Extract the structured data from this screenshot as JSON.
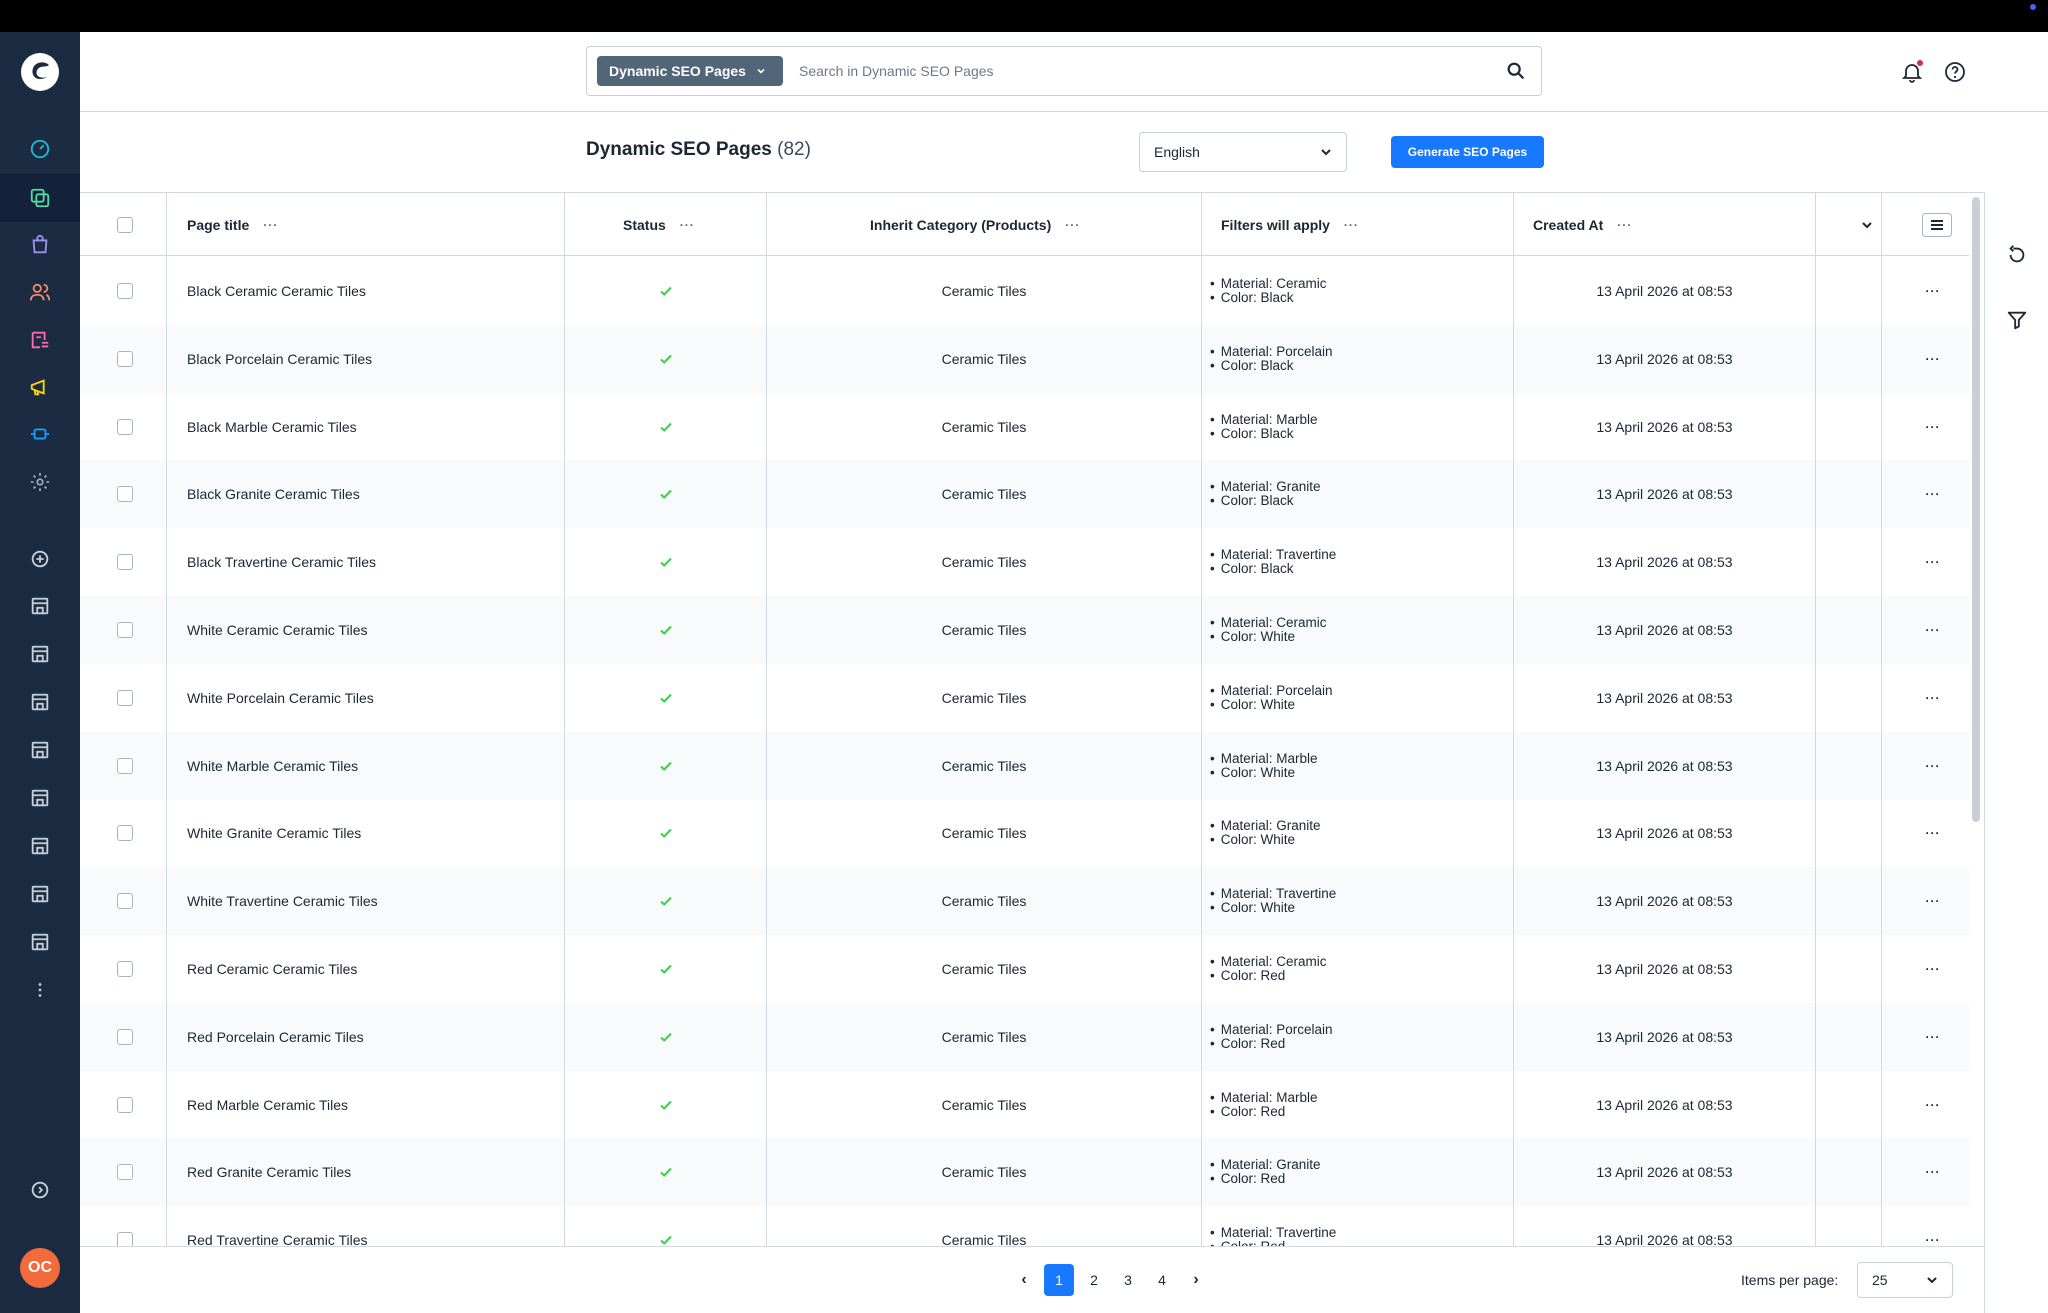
{
  "app": {
    "user_initials": "OC",
    "accent_color": "#1679ff"
  },
  "header": {
    "search_module": "Dynamic SEO Pages",
    "search_placeholder": "Search in Dynamic SEO Pages"
  },
  "page": {
    "title": "Dynamic SEO Pages",
    "count": "(82)",
    "language": "English",
    "generate_button": "Generate SEO Pages"
  },
  "columns": {
    "title": "Page title",
    "status": "Status",
    "category": "Inherit Category (Products)",
    "filters": "Filters will apply",
    "created": "Created At"
  },
  "rows": [
    {
      "title": "Black Ceramic Ceramic Tiles",
      "status": "active",
      "category": "Ceramic Tiles",
      "filters": [
        "Material: Ceramic",
        "Color: Black"
      ],
      "created": "13 April 2026 at 08:53"
    },
    {
      "title": "Black Porcelain Ceramic Tiles",
      "status": "active",
      "category": "Ceramic Tiles",
      "filters": [
        "Material: Porcelain",
        "Color: Black"
      ],
      "created": "13 April 2026 at 08:53"
    },
    {
      "title": "Black Marble Ceramic Tiles",
      "status": "active",
      "category": "Ceramic Tiles",
      "filters": [
        "Material: Marble",
        "Color: Black"
      ],
      "created": "13 April 2026 at 08:53"
    },
    {
      "title": "Black Granite Ceramic Tiles",
      "status": "active",
      "category": "Ceramic Tiles",
      "filters": [
        "Material: Granite",
        "Color: Black"
      ],
      "created": "13 April 2026 at 08:53"
    },
    {
      "title": "Black Travertine Ceramic Tiles",
      "status": "active",
      "category": "Ceramic Tiles",
      "filters": [
        "Material: Travertine",
        "Color: Black"
      ],
      "created": "13 April 2026 at 08:53"
    },
    {
      "title": "White Ceramic Ceramic Tiles",
      "status": "active",
      "category": "Ceramic Tiles",
      "filters": [
        "Material: Ceramic",
        "Color: White"
      ],
      "created": "13 April 2026 at 08:53"
    },
    {
      "title": "White Porcelain Ceramic Tiles",
      "status": "active",
      "category": "Ceramic Tiles",
      "filters": [
        "Material: Porcelain",
        "Color: White"
      ],
      "created": "13 April 2026 at 08:53"
    },
    {
      "title": "White Marble Ceramic Tiles",
      "status": "active",
      "category": "Ceramic Tiles",
      "filters": [
        "Material: Marble",
        "Color: White"
      ],
      "created": "13 April 2026 at 08:53"
    },
    {
      "title": "White Granite Ceramic Tiles",
      "status": "active",
      "category": "Ceramic Tiles",
      "filters": [
        "Material: Granite",
        "Color: White"
      ],
      "created": "13 April 2026 at 08:53"
    },
    {
      "title": "White Travertine Ceramic Tiles",
      "status": "active",
      "category": "Ceramic Tiles",
      "filters": [
        "Material: Travertine",
        "Color: White"
      ],
      "created": "13 April 2026 at 08:53"
    },
    {
      "title": "Red Ceramic Ceramic Tiles",
      "status": "active",
      "category": "Ceramic Tiles",
      "filters": [
        "Material: Ceramic",
        "Color: Red"
      ],
      "created": "13 April 2026 at 08:53"
    },
    {
      "title": "Red Porcelain Ceramic Tiles",
      "status": "active",
      "category": "Ceramic Tiles",
      "filters": [
        "Material: Porcelain",
        "Color: Red"
      ],
      "created": "13 April 2026 at 08:53"
    },
    {
      "title": "Red Marble Ceramic Tiles",
      "status": "active",
      "category": "Ceramic Tiles",
      "filters": [
        "Material: Marble",
        "Color: Red"
      ],
      "created": "13 April 2026 at 08:53"
    },
    {
      "title": "Red Granite Ceramic Tiles",
      "status": "active",
      "category": "Ceramic Tiles",
      "filters": [
        "Material: Granite",
        "Color: Red"
      ],
      "created": "13 April 2026 at 08:53"
    },
    {
      "title": "Red Travertine Ceramic Tiles",
      "status": "active",
      "category": "Ceramic Tiles",
      "filters": [
        "Material: Travertine",
        "Color: Red"
      ],
      "created": "13 April 2026 at 08:53"
    }
  ],
  "pagination": {
    "pages": [
      "1",
      "2",
      "3",
      "4"
    ],
    "current": "1",
    "items_per_page_label": "Items per page:",
    "items_per_page": "25"
  },
  "icons": {
    "sidebar": [
      "dashboard-icon",
      "catalogue-icon",
      "orders-icon",
      "customers-icon",
      "content-icon",
      "marketing-icon",
      "extensions-icon",
      "settings-icon",
      "add-sales-channel-icon",
      "storefront-icon",
      "storefront-icon",
      "storefront-icon",
      "storefront-icon",
      "storefront-icon",
      "storefront-icon",
      "storefront-icon",
      "storefront-icon",
      "more-icon",
      "collapse-icon"
    ],
    "sidebar_colors": {
      "dashboard": "#1fb8d8",
      "catalogue": "#57d9a3",
      "orders": "#a092f0",
      "customers": "#f88962",
      "content": "#ff68b4",
      "marketing": "#ffd700",
      "extensions": "#189eff",
      "settings": "#9aa8b5"
    }
  }
}
